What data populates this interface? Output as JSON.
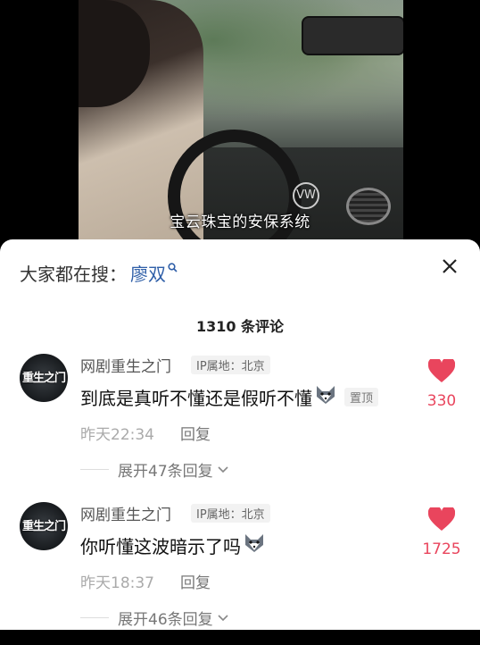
{
  "video": {
    "subtitle": "宝云珠宝的安保系统",
    "car_logo": "VW"
  },
  "sheet": {
    "search_prefix": "大家都在搜：",
    "search_term": "廖双",
    "comment_count_label": "1310 条评论"
  },
  "comments": [
    {
      "author": "网剧重生之门",
      "avatar_text": "重生之门",
      "ip_label": "IP属地：北京",
      "text": "到底是真听不懂还是假听不懂",
      "emoji": "wolf-emoji",
      "pin_label": "置顶",
      "time": "昨天22:34",
      "reply_label": "回复",
      "expand_label": "展开47条回复",
      "likes": "330"
    },
    {
      "author": "网剧重生之门",
      "avatar_text": "重生之门",
      "ip_label": "IP属地：北京",
      "text": "你听懂这波暗示了吗",
      "emoji": "wolf-emoji",
      "time": "昨天18:37",
      "reply_label": "回复",
      "expand_label": "展开46条回复",
      "likes": "1725"
    }
  ],
  "colors": {
    "like_red": "#e9455d",
    "search_blue": "#2f5fa8"
  }
}
